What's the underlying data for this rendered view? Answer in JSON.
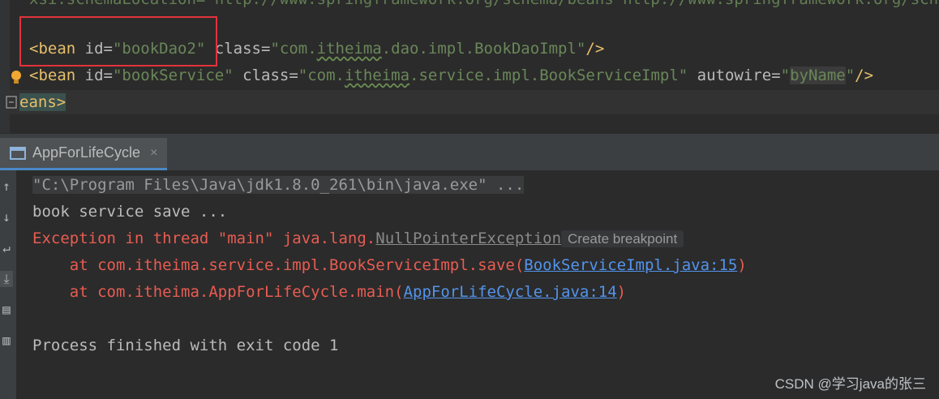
{
  "editor": {
    "partial_line": "xsi:schemaLocation=\"http://www.springframework.org/schema/beans http://www.springframework.org/schema/beans/spring-beans.xsd\">",
    "line1": {
      "tag_open": "<bean",
      "attr_id": " id=",
      "id_value": "\"bookDao2\"",
      "attr_class": " class=",
      "class_q1": "\"com.",
      "class_pkg": "itheima",
      "class_rest": ".dao.impl.BookDaoImpl\"",
      "tag_close": "/>"
    },
    "line2": {
      "tag_open": "<bean",
      "attr_id": " id=",
      "id_value": "\"bookService\"",
      "attr_class": " class=",
      "class_q1": "\"com.",
      "class_pkg": "itheima",
      "class_rest": ".service.impl.BookServiceImpl\"",
      "attr_autowire": " autowire=",
      "autowire_q1": "\"",
      "autowire_value": "byName",
      "autowire_q2": "\"",
      "tag_close": "/>"
    },
    "line3": {
      "text": "eans>"
    }
  },
  "run_panel": {
    "tab_label": "AppForLifeCycle",
    "tab_close": "×"
  },
  "console": {
    "cmd": "\"C:\\Program Files\\Java\\jdk1.8.0_261\\bin\\java.exe\" ...",
    "out1": "book service save ...",
    "exc_prefix": "Exception in thread \"main\" java.lang.",
    "exc_class": "NullPointerException",
    "create_breakpoint": "Create breakpoint",
    "trace1_prefix": "    at com.itheima.service.impl.BookServiceImpl.save(",
    "trace1_link": "BookServiceImpl.java:15",
    "trace1_suffix": ")",
    "trace2_prefix": "    at com.itheima.AppForLifeCycle.main(",
    "trace2_link": "AppForLifeCycle.java:14",
    "trace2_suffix": ")",
    "exit": "Process finished with exit code 1"
  },
  "side_icons": [
    "up-arrow-icon",
    "down-arrow-icon",
    "soft-wrap-icon",
    "scroll-to-end-icon",
    "print-icon",
    "trash-icon"
  ],
  "watermark": "CSDN @学习java的张三",
  "colors": {
    "highlight_box": "#e2333b",
    "error_text": "#e85c52",
    "link": "#5394ec"
  }
}
